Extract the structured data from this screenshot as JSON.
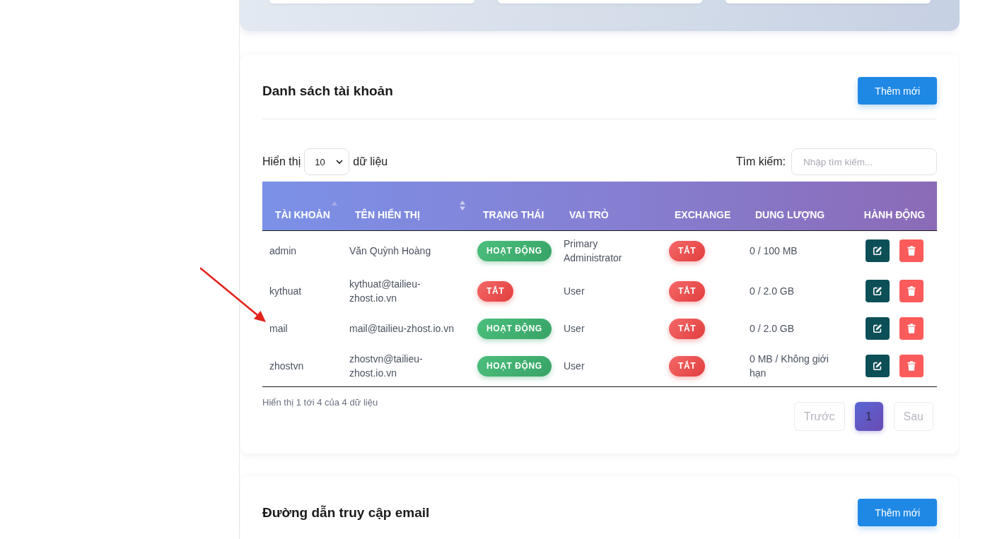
{
  "accounts_card": {
    "title": "Danh sách tài khoản",
    "add_button": "Thêm mới",
    "page_size": {
      "label_before": "Hiển thị",
      "value": "10",
      "label_after": "dữ liệu"
    },
    "search": {
      "label": "Tìm kiếm:",
      "placeholder": "Nhập tìm kiếm..."
    },
    "table": {
      "columns": [
        {
          "label": "TÀI KHOẢN",
          "sortable": true,
          "sorted": true
        },
        {
          "label": "TÊN HIỂN THỊ",
          "sortable": true,
          "sorted": false
        },
        {
          "label": "TRẠNG THÁI",
          "sortable": false
        },
        {
          "label": "VAI TRÒ",
          "sortable": false
        },
        {
          "label": "EXCHANGE",
          "sortable": false
        },
        {
          "label": "DUNG LƯỢNG",
          "sortable": false
        },
        {
          "label": "HÀNH ĐỘNG",
          "sortable": false
        }
      ],
      "rows": [
        {
          "username": "admin",
          "display_name": "Văn Quỳnh Hoàng",
          "status": {
            "label": "HOẠT ĐỘNG",
            "on": true
          },
          "role": "Primary Administrator",
          "exchange": {
            "label": "TẮT",
            "on": false
          },
          "quota": "0 / 100 MB",
          "actions": [
            {
              "kind": "edit"
            },
            {
              "kind": "delete"
            }
          ]
        },
        {
          "username": "kythuat",
          "display_name": "kythuat@tailieu-zhost.io.vn",
          "status": {
            "label": "TẮT",
            "on": false
          },
          "role": "User",
          "exchange": {
            "label": "TẮT",
            "on": false
          },
          "quota": "0 / 2.0 GB",
          "actions": [
            {
              "kind": "edit"
            },
            {
              "kind": "delete"
            }
          ]
        },
        {
          "username": "mail",
          "display_name": "mail@tailieu-zhost.io.vn",
          "status": {
            "label": "HOẠT ĐỘNG",
            "on": true
          },
          "role": "User",
          "exchange": {
            "label": "TẮT",
            "on": false
          },
          "quota": "0 / 2.0 GB",
          "actions": [
            {
              "kind": "edit"
            },
            {
              "kind": "delete"
            }
          ]
        },
        {
          "username": "zhostvn",
          "display_name": "zhostvn@tailieu-zhost.io.vn",
          "status": {
            "label": "HOẠT ĐỘNG",
            "on": true
          },
          "role": "User",
          "exchange": {
            "label": "TẮT",
            "on": false
          },
          "quota": "0 MB / Không giới hạn",
          "actions": [
            {
              "kind": "edit"
            },
            {
              "kind": "delete"
            }
          ]
        }
      ]
    },
    "info": "Hiển thị 1 tới 4 của 4 dữ liệu",
    "pagination": {
      "previous": {
        "label": "Trước",
        "disabled": true
      },
      "pages": [
        {
          "label": "1",
          "selected": true
        }
      ],
      "next": {
        "label": "Sau",
        "disabled": true
      }
    }
  },
  "email_links_card": {
    "title": "Đường dẫn truy cập email",
    "add_button": "Thêm mới"
  },
  "annotations": [
    {
      "kind": "arrow"
    }
  ]
}
